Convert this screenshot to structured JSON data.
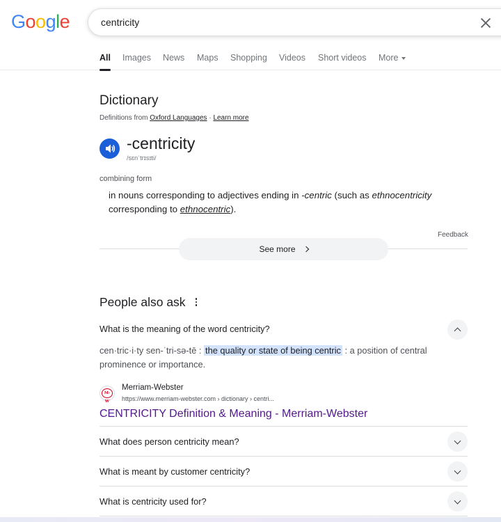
{
  "logo": {
    "letters": [
      "G",
      "o",
      "o",
      "g",
      "l",
      "e"
    ],
    "colors": [
      "#4285F4",
      "#EA4335",
      "#FBBC05",
      "#4285F4",
      "#34A853",
      "#EA4335"
    ]
  },
  "search": {
    "query": "centricity"
  },
  "tabs": [
    {
      "label": "All",
      "active": true
    },
    {
      "label": "Images"
    },
    {
      "label": "News"
    },
    {
      "label": "Maps"
    },
    {
      "label": "Shopping"
    },
    {
      "label": "Videos"
    },
    {
      "label": "Short videos"
    },
    {
      "label": "More"
    }
  ],
  "dictionary": {
    "title": "Dictionary",
    "definitions_from": "Definitions from",
    "source_link": "Oxford Languages",
    "separator": "·",
    "learn_more": "Learn more",
    "word": "-centricity",
    "phonetic": "/sɛnˈtrɪsɪti/",
    "word_type": "combining form",
    "definition_part1": "in nouns corresponding to adjectives ending in",
    "definition_em1": "-centric",
    "definition_part2": "(such as",
    "definition_em2": "ethnocentricity",
    "definition_part3": "corresponding to",
    "definition_link": "ethnocentric",
    "definition_end": ").",
    "feedback": "Feedback",
    "see_more": "See more"
  },
  "paa": {
    "title": "People also ask",
    "expanded": {
      "question": "What is the meaning of the word centricity?",
      "answer_pre": "cen·tric·i·ty sen-ˈtri-sə-tē :",
      "answer_highlight": "the quality or state of being centric",
      "answer_post": ": a position of central prominence or importance.",
      "source_name": "Merriam-Webster",
      "source_url": "https://www.merriam-webster.com › dictionary › centri...",
      "source_favicon_text": "M-W",
      "result_title": "CENTRICITY Definition & Meaning - Merriam-Webster"
    },
    "questions": [
      "What does person centricity mean?",
      "What is meant by customer centricity?",
      "What is centricity used for?"
    ]
  }
}
